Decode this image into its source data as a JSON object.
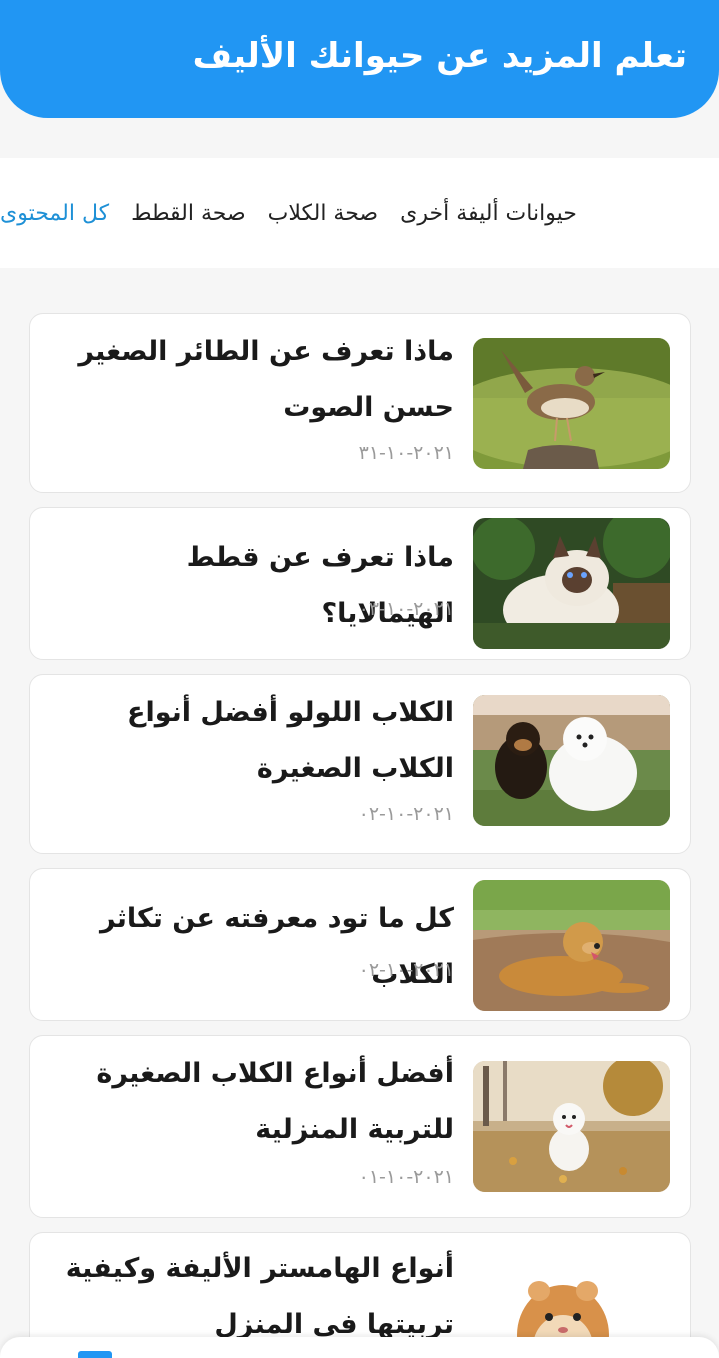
{
  "header": {
    "title": "تعلم المزيد عن حيوانك الأليف"
  },
  "tabs": [
    {
      "label": "كل المحتوى",
      "active": true
    },
    {
      "label": "صحة القطط",
      "active": false
    },
    {
      "label": "صحة الكلاب",
      "active": false
    },
    {
      "label": "حيوانات أليفة أخرى",
      "active": false
    }
  ],
  "articles": [
    {
      "title": "ماذا تعرف عن الطائر الصغير حسن الصوت",
      "date": "٢٠٢١-١٠-٣١",
      "image": "bird-photo"
    },
    {
      "title": "ماذا تعرف عن قطط الهيمالايا؟",
      "date": "٢٠٢١-١٠-٠٣",
      "image": "himalayan-cat-photo"
    },
    {
      "title": "الكلاب اللولو أفضل أنواع الكلاب الصغيرة",
      "date": "٢٠٢١-١٠-٠٢",
      "image": "pomeranian-dogs-photo"
    },
    {
      "title": "كل ما تود معرفته عن تكاثر الكلاب",
      "date": "٢٠٢١-١٠-٠٢",
      "image": "golden-retriever-photo"
    },
    {
      "title": "أفضل أنواع الكلاب الصغيرة للتربية المنزلية",
      "date": "٢٠٢١-١٠-٠١",
      "image": "bichon-dog-photo"
    },
    {
      "title": "أنواع الهامستر الأليفة وكيفية تربيتها في المنزل",
      "date": "",
      "image": "hamster-photo"
    }
  ],
  "colors": {
    "accent": "#2196f3",
    "active_tab": "#1e90d6"
  }
}
